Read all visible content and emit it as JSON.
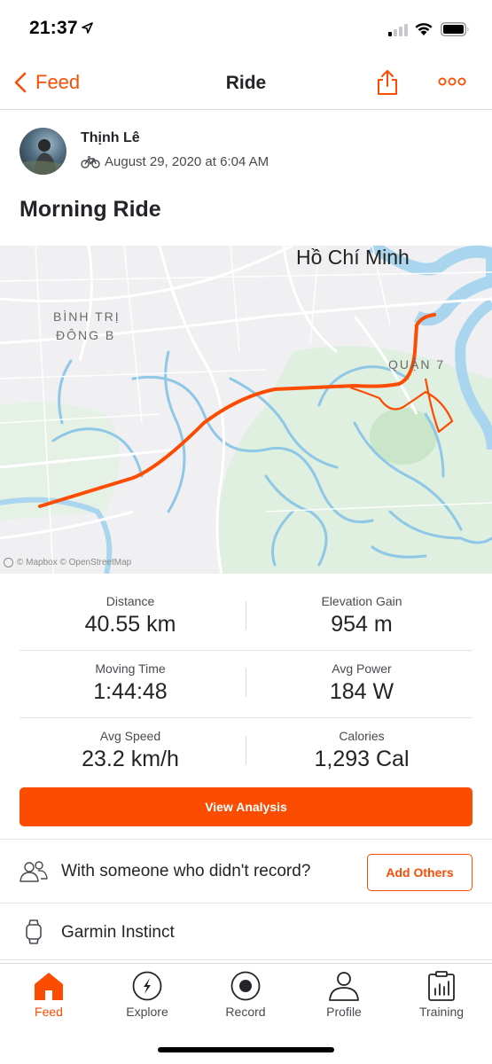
{
  "status_bar": {
    "time": "21:37",
    "icons": [
      "location-arrow-icon",
      "cellular-signal-icon",
      "wifi-icon",
      "battery-icon"
    ]
  },
  "nav": {
    "back_label": "Feed",
    "title": "Ride",
    "share_icon": "share-icon",
    "more_icon": "more-icon"
  },
  "activity": {
    "athlete_name": "Thịnh Lê",
    "sport_icon": "bike-icon",
    "date": "August 29, 2020 at 6:04 AM",
    "title": "Morning Ride"
  },
  "map": {
    "city_label": "Hồ Chí Minh",
    "district_label_1a": "BÌNH TRỊ",
    "district_label_1b": "ĐÔNG B",
    "district_label_2": "QUẬN 7",
    "attribution": "© Mapbox © OpenStreetMap",
    "route_color": "#fc4c02"
  },
  "stats": [
    {
      "label": "Distance",
      "value": "40.55 km"
    },
    {
      "label": "Elevation Gain",
      "value": "954 m"
    },
    {
      "label": "Moving Time",
      "value": "1:44:48"
    },
    {
      "label": "Avg Power",
      "value": "184 W"
    },
    {
      "label": "Avg Speed",
      "value": "23.2 km/h"
    },
    {
      "label": "Calories",
      "value": "1,293 Cal"
    }
  ],
  "actions": {
    "view_analysis": "View Analysis",
    "with_prompt": "With someone who didn't record?",
    "add_others": "Add Others",
    "device": "Garmin Instinct"
  },
  "tabs": [
    {
      "label": "Feed",
      "icon": "home-icon",
      "active": true
    },
    {
      "label": "Explore",
      "icon": "compass-icon",
      "active": false
    },
    {
      "label": "Record",
      "icon": "record-icon",
      "active": false
    },
    {
      "label": "Profile",
      "icon": "profile-icon",
      "active": false
    },
    {
      "label": "Training",
      "icon": "training-icon",
      "active": false
    }
  ],
  "colors": {
    "accent": "#fc4c02",
    "text": "#242428"
  }
}
